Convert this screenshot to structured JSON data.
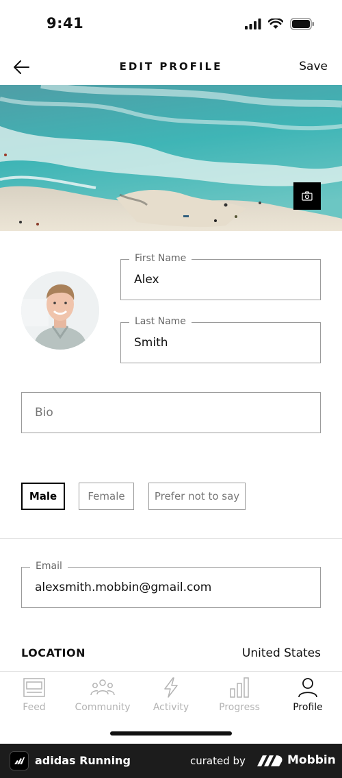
{
  "status_bar": {
    "time": "9:41"
  },
  "nav": {
    "title": "EDIT PROFILE",
    "save_label": "Save"
  },
  "profile": {
    "first_name_label": "First Name",
    "first_name": "Alex",
    "last_name_label": "Last Name",
    "last_name": "Smith",
    "bio_placeholder": "Bio"
  },
  "gender": {
    "options": [
      "Male",
      "Female",
      "Prefer not to say"
    ],
    "selected": "Male"
  },
  "email": {
    "label": "Email",
    "value": "alexsmith.mobbin@gmail.com"
  },
  "location": {
    "label": "LOCATION",
    "value": "United States"
  },
  "tabs": [
    {
      "label": "Feed",
      "icon": "feed-icon",
      "active": false
    },
    {
      "label": "Community",
      "icon": "community-icon",
      "active": false
    },
    {
      "label": "Activity",
      "icon": "lightning-icon",
      "active": false
    },
    {
      "label": "Progress",
      "icon": "bar-chart-icon",
      "active": false
    },
    {
      "label": "Profile",
      "icon": "person-icon",
      "active": true
    }
  ],
  "banner": {
    "app_name": "adidas Running",
    "curated_by": "curated by",
    "brand": "Mobbin"
  },
  "colors": {
    "active": "#111111",
    "inactive": "#b3b3b3",
    "border": "#9a9a9a",
    "banner_bg": "#1c1c1c"
  }
}
